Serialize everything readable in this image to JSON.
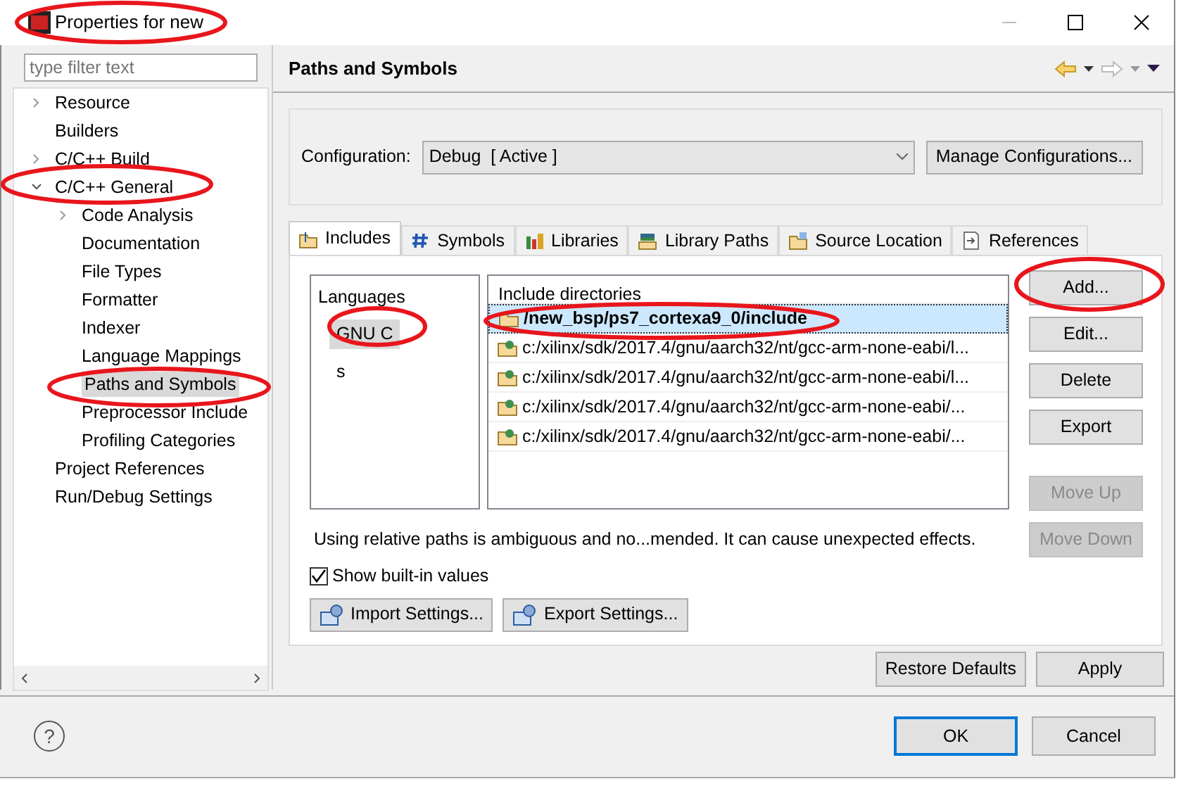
{
  "window": {
    "title": "Properties for new"
  },
  "filter": {
    "placeholder": "type filter text"
  },
  "tree": [
    {
      "label": "Resource",
      "expanded": false,
      "selected": false
    },
    {
      "label": "Builders",
      "selected": false
    },
    {
      "label": "C/C++ Build",
      "expanded": false,
      "selected": false
    },
    {
      "label": "C/C++ General",
      "expanded": true,
      "selected": false,
      "children": [
        {
          "label": "Code Analysis",
          "expanded": false,
          "selected": false
        },
        {
          "label": "Documentation",
          "selected": false
        },
        {
          "label": "File Types",
          "selected": false
        },
        {
          "label": "Formatter",
          "selected": false
        },
        {
          "label": "Indexer",
          "selected": false
        },
        {
          "label": "Language Mappings",
          "selected": false
        },
        {
          "label": "Paths and Symbols",
          "selected": true
        },
        {
          "label": "Preprocessor Include",
          "selected": false
        },
        {
          "label": "Profiling Categories",
          "selected": false
        }
      ]
    },
    {
      "label": "Project References",
      "selected": false
    },
    {
      "label": "Run/Debug Settings",
      "selected": false
    }
  ],
  "page_title": "Paths and Symbols",
  "configuration": {
    "label": "Configuration:",
    "value": "Debug  [ Active ]",
    "button": "Manage Configurations..."
  },
  "tabs": [
    {
      "label": "Includes",
      "selected": true
    },
    {
      "label": "Symbols",
      "selected": false
    },
    {
      "label": "Libraries",
      "selected": false
    },
    {
      "label": "Library Paths",
      "selected": false
    },
    {
      "label": "Source Location",
      "selected": false
    },
    {
      "label": "References",
      "selected": false
    }
  ],
  "languages": {
    "header": "Languages",
    "items": [
      {
        "label": "GNU C",
        "selected": true
      },
      {
        "label": "s",
        "selected": false
      }
    ]
  },
  "include_directories": {
    "header": "Include directories",
    "rows": [
      {
        "path": "/new_bsp/ps7_cortexa9_0/include",
        "kind": "workspace",
        "selected": true
      },
      {
        "path": "c:/xilinx/sdk/2017.4/gnu/aarch32/nt/gcc-arm-none-eabi/l...",
        "kind": "builtin",
        "selected": false
      },
      {
        "path": "c:/xilinx/sdk/2017.4/gnu/aarch32/nt/gcc-arm-none-eabi/l...",
        "kind": "builtin",
        "selected": false
      },
      {
        "path": "c:/xilinx/sdk/2017.4/gnu/aarch32/nt/gcc-arm-none-eabi/...",
        "kind": "builtin",
        "selected": false
      },
      {
        "path": "c:/xilinx/sdk/2017.4/gnu/aarch32/nt/gcc-arm-none-eabi/...",
        "kind": "builtin",
        "selected": false
      }
    ]
  },
  "side_buttons": [
    {
      "label": "Add...",
      "disabled": false
    },
    {
      "label": "Edit...",
      "disabled": false
    },
    {
      "label": "Delete",
      "disabled": false
    },
    {
      "label": "Export",
      "disabled": false
    },
    {
      "label": "Move Up",
      "disabled": true
    },
    {
      "label": "Move Down",
      "disabled": true
    }
  ],
  "notice": "Using relative paths is ambiguous and no...mended. It can cause unexpected effects.",
  "show_builtin": {
    "label": "Show built-in values",
    "checked": true
  },
  "settings_buttons": [
    "Import Settings...",
    "Export Settings..."
  ],
  "page_buttons": [
    "Restore Defaults",
    "Apply"
  ],
  "help": "?",
  "dialog_buttons": [
    {
      "label": "OK",
      "default": true
    },
    {
      "label": "Cancel",
      "default": false
    }
  ]
}
